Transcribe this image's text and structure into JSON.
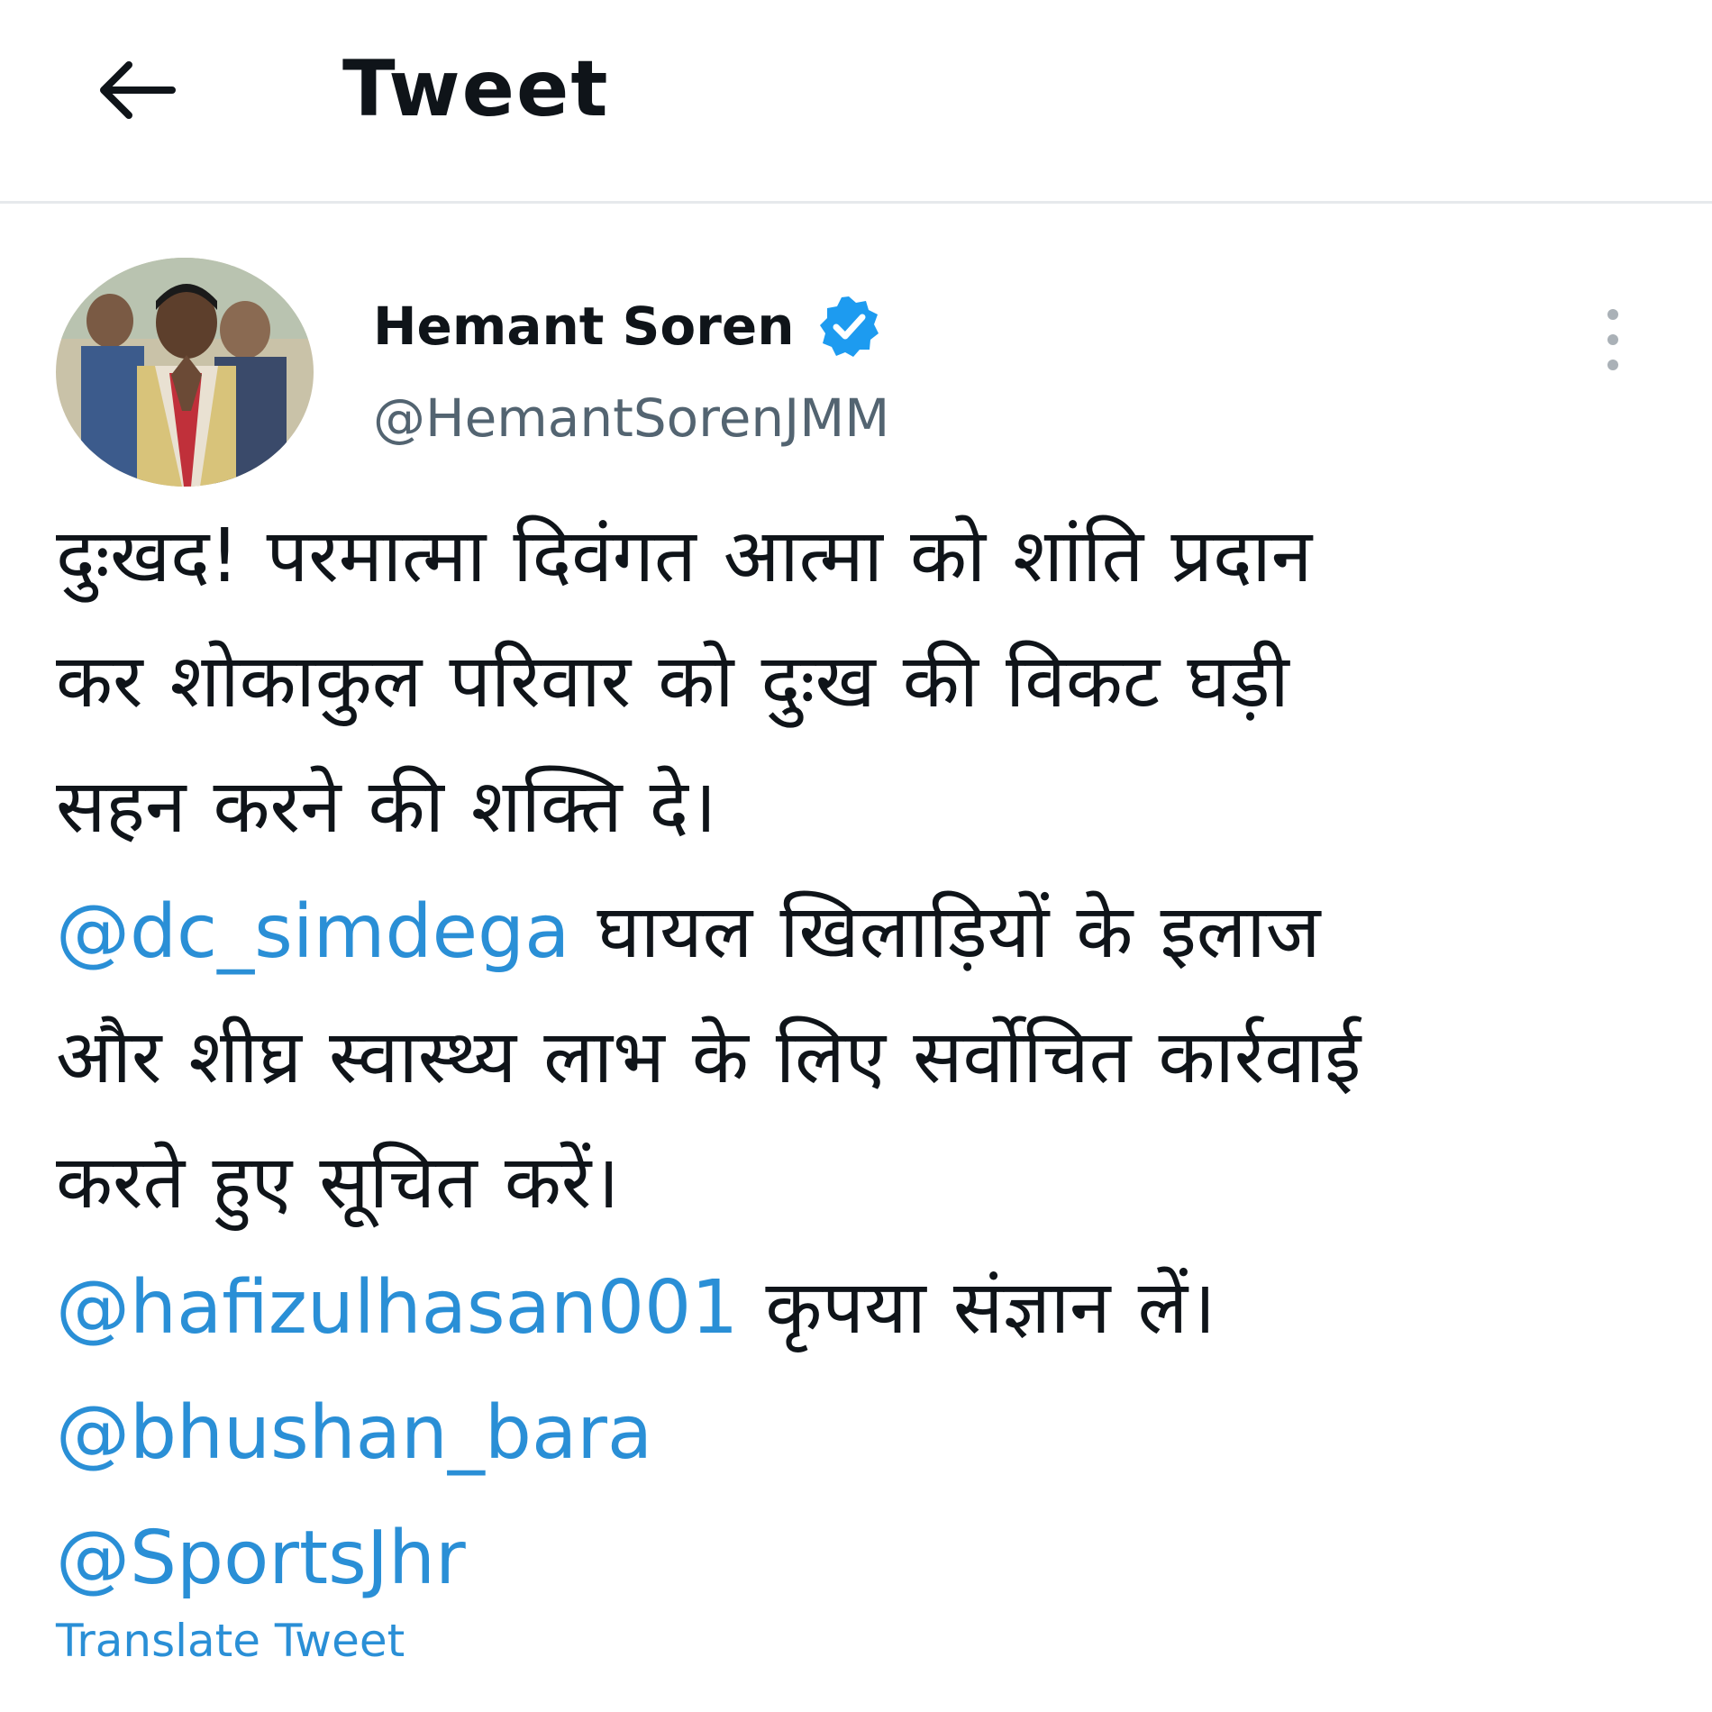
{
  "header": {
    "back_icon": "arrow-left-icon",
    "title": "Tweet"
  },
  "author": {
    "avatar_icon": "profile-photo",
    "name": "Hemant Soren",
    "verified_icon": "verified-badge-icon",
    "handle": "@HemantSorenJMM",
    "more_icon": "more-vertical-icon"
  },
  "tweet": {
    "line1": "दुःखद! परमात्मा दिवंगत आत्मा को शांति प्रदान",
    "line2": "कर शोकाकुल परिवार को दुःख की विकट घड़ी",
    "line3": "सहन करने की शक्ति दे।",
    "mention1": "@dc_simdega",
    "line4_text": " घायल खिलाड़ियों के इलाज",
    "line5": "और शीघ्र स्वास्थ्य लाभ के लिए सर्वोचित कार्रवाई",
    "line6": "करते हुए सूचित करें।",
    "mention2": "@hafizulhasan001",
    "line7_text": " कृपया संज्ञान लें।",
    "mention3": "@bhushan_bara",
    "mention4": "@SportsJhr"
  },
  "translate_label": "Translate Tweet",
  "colors": {
    "text": "#0f1419",
    "secondary": "#536471",
    "link": "#2a8fd6",
    "verified": "#1d9bf0",
    "divider": "#e6e9ec"
  }
}
